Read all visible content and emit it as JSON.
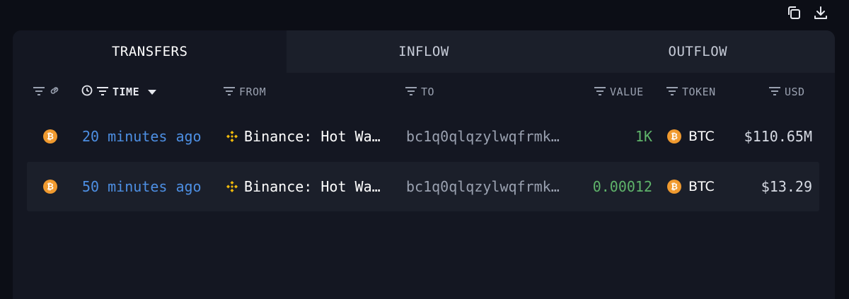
{
  "tabs": [
    {
      "label": "TRANSFERS",
      "active": true
    },
    {
      "label": "INFLOW",
      "active": false
    },
    {
      "label": "OUTFLOW",
      "active": false
    }
  ],
  "columns": {
    "time": "TIME",
    "from": "FROM",
    "to": "TO",
    "value": "VALUE",
    "token": "TOKEN",
    "usd": "USD"
  },
  "rows": [
    {
      "chain_icon": "bitcoin-icon",
      "time": "20 minutes ago",
      "from": "Binance: Hot Wa…",
      "from_icon": "binance-icon",
      "to": "bc1q0qlqzylwqfrmk…",
      "value": "1K",
      "token_icon": "bitcoin-icon",
      "token": "BTC",
      "usd": "$110.65M"
    },
    {
      "chain_icon": "bitcoin-icon",
      "time": "50 minutes ago",
      "from": "Binance: Hot Wa…",
      "from_icon": "binance-icon",
      "to": "bc1q0qlqzylwqfrmk…",
      "value": "0.00012",
      "token_icon": "bitcoin-icon",
      "token": "BTC",
      "usd": "$13.29"
    }
  ],
  "colors": {
    "background": "#0c0e16",
    "panel": "#141722",
    "inactive_tab": "#1b1f2a",
    "link_blue": "#4d8fe3",
    "value_green": "#5fb36a",
    "bitcoin_orange": "#f09a2f",
    "binance_yellow": "#f0b90b"
  }
}
